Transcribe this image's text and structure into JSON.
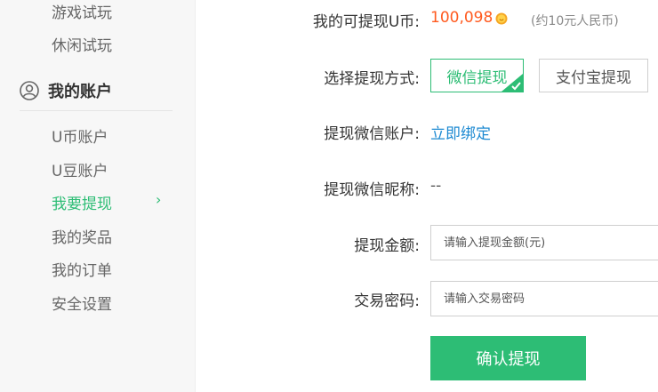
{
  "sidebar": {
    "top_items": [
      "游戏试玩",
      "休闲试玩"
    ],
    "section_title": "我的账户",
    "section_icon": "user-icon",
    "items": [
      {
        "label": "U币账户",
        "active": false
      },
      {
        "label": "U豆账户",
        "active": false
      },
      {
        "label": "我要提现",
        "active": true
      },
      {
        "label": "我的奖品",
        "active": false
      },
      {
        "label": "我的订单",
        "active": false
      },
      {
        "label": "安全设置",
        "active": false
      }
    ],
    "active_indicator": "›"
  },
  "form": {
    "balance_label": "我的可提现U币:",
    "balance_value": "100,098",
    "balance_icon": "coin-icon",
    "balance_note": "(约10元人民币)",
    "method_label": "选择提现方式:",
    "methods": [
      {
        "label": "微信提现",
        "selected": true
      },
      {
        "label": "支付宝提现",
        "selected": false
      }
    ],
    "account_label": "提现微信账户:",
    "account_link": "立即绑定",
    "nickname_label": "提现微信昵称:",
    "nickname_value": "--",
    "amount_label": "提现金额:",
    "amount_placeholder": "请输入提现金额(元)",
    "password_label": "交易密码:",
    "password_placeholder": "请输入交易密码",
    "submit_label": "确认提现"
  },
  "colors": {
    "accent": "#2dbd75",
    "balance": "#ff5a1f",
    "link": "#1e8ad2"
  }
}
